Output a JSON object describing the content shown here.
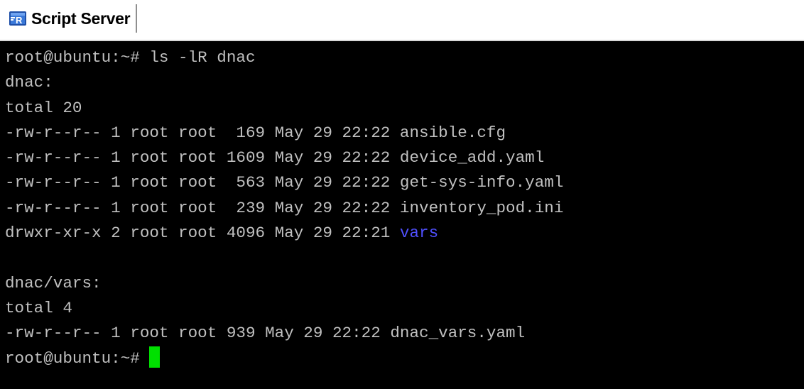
{
  "window": {
    "title": "Script Server",
    "icon": "putty-terminal-icon"
  },
  "terminal": {
    "colors": {
      "background": "#000000",
      "text": "#c0c0c0",
      "directory": "#5050ff",
      "cursor": "#00e000"
    },
    "lines": [
      {
        "text": "root@ubuntu:~# ls -lR dnac"
      },
      {
        "text": "dnac:"
      },
      {
        "text": "total 20"
      },
      {
        "text": "-rw-r--r-- 1 root root  169 May 29 22:22 ansible.cfg"
      },
      {
        "text": "-rw-r--r-- 1 root root 1609 May 29 22:22 device_add.yaml"
      },
      {
        "text": "-rw-r--r-- 1 root root  563 May 29 22:22 get-sys-info.yaml"
      },
      {
        "text": "-rw-r--r-- 1 root root  239 May 29 22:22 inventory_pod.ini"
      },
      {
        "prefix": "drwxr-xr-x 2 root root 4096 May 29 22:21 ",
        "dir": "vars"
      },
      {
        "text": ""
      },
      {
        "text": "dnac/vars:"
      },
      {
        "text": "total 4"
      },
      {
        "text": "-rw-r--r-- 1 root root 939 May 29 22:22 dnac_vars.yaml"
      }
    ],
    "prompt": "root@ubuntu:~# "
  }
}
